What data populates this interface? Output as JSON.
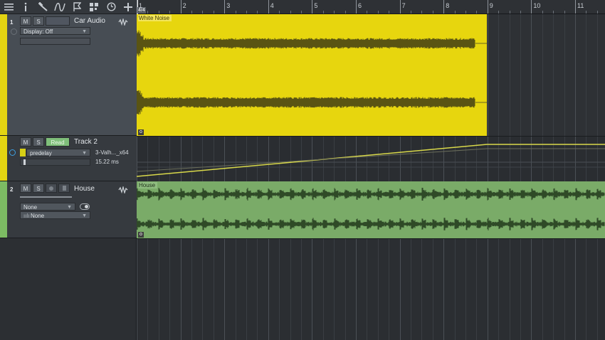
{
  "toolbar": {
    "icons": [
      "menu-icon",
      "info-icon",
      "wrench-icon",
      "automation-icon",
      "marker-icon",
      "grid-icon",
      "metronome-icon",
      "add-icon"
    ]
  },
  "ruler": {
    "time_signature": "4/4",
    "bars": [
      "1",
      "2",
      "3",
      "4",
      "5",
      "6",
      "7",
      "8",
      "9",
      "10",
      "11"
    ]
  },
  "tracks": [
    {
      "number": "1",
      "mute": "M",
      "solo": "S",
      "name": "Car Audio",
      "display": "Display: Off",
      "color": "#e3d412"
    },
    {
      "mute": "M",
      "solo": "S",
      "mode": "Read",
      "name": "Track 2",
      "parameter": "predelay",
      "plugin": "3-Valh..._x64",
      "value": "15.22 ms",
      "color": "#e3d412"
    },
    {
      "number": "2",
      "mute": "M",
      "solo": "S",
      "name": "House",
      "input": "None",
      "output": "None",
      "color": "#7cbb63"
    }
  ],
  "events": {
    "white_noise": {
      "name": "White Noise",
      "foot": "o",
      "color": "#e7d60e"
    },
    "house": {
      "name": "House",
      "foot": "o",
      "color": "#7aab68"
    }
  },
  "automation": {
    "color": "#d9d94a"
  }
}
